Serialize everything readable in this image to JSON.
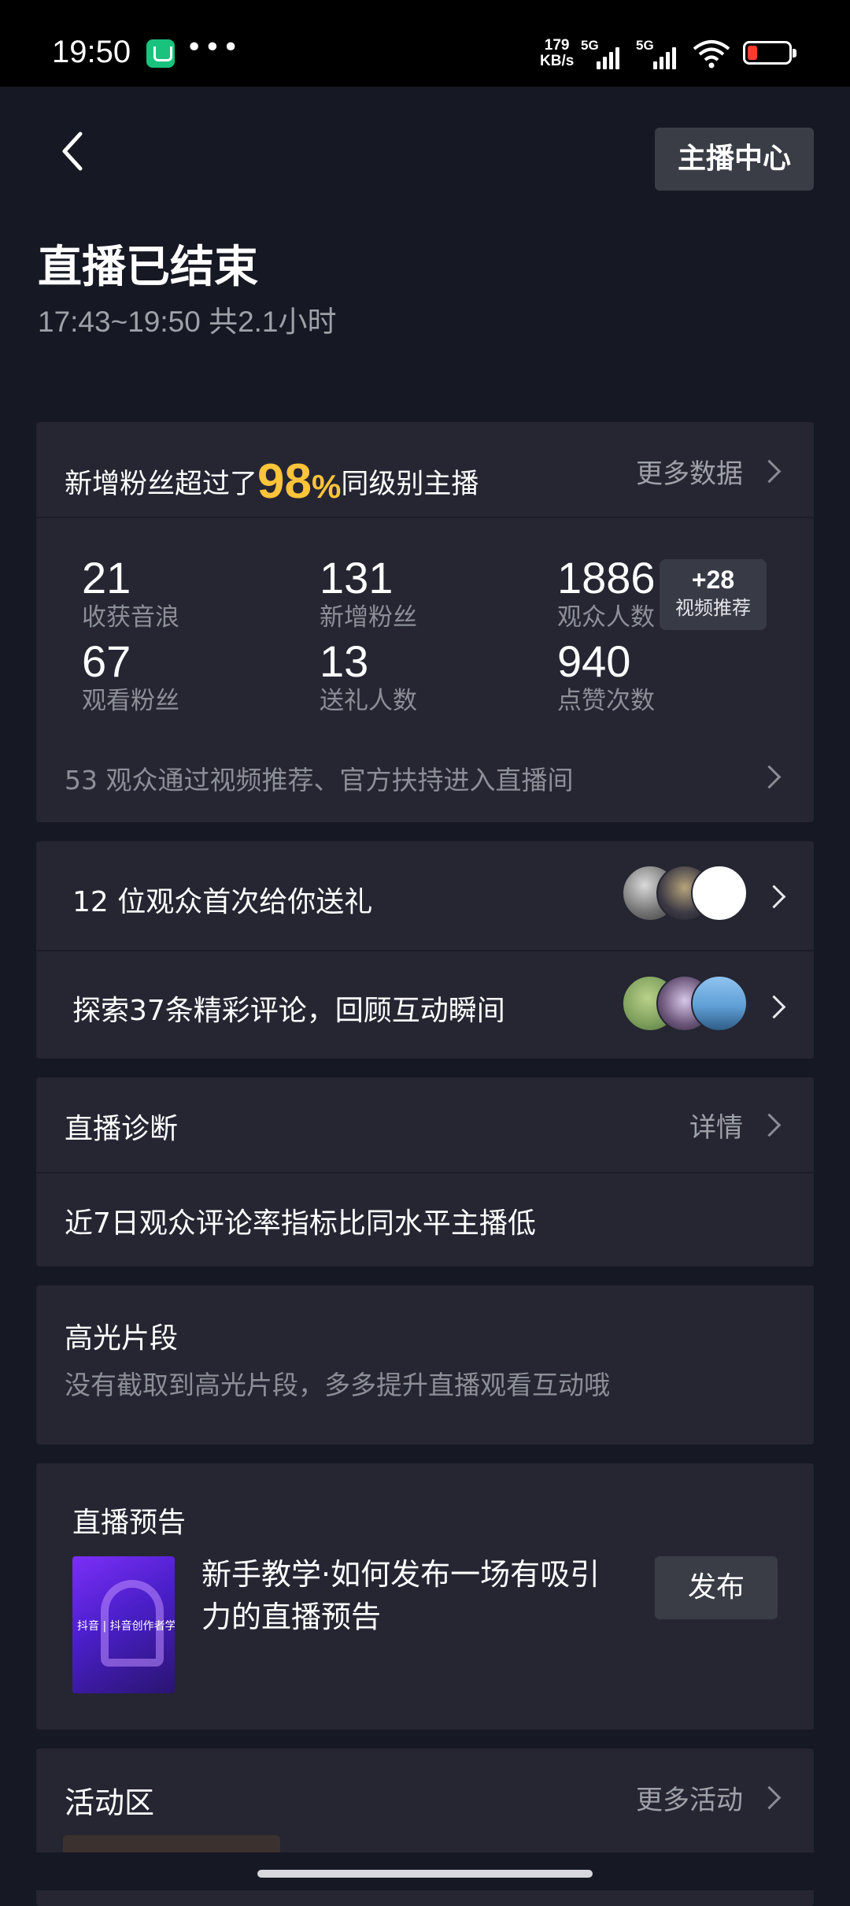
{
  "status_bar": {
    "time": "19:50",
    "speed_value": "179",
    "speed_unit": "KB/s",
    "network1": "5G",
    "network2": "5G",
    "battery_color": "#ff3b30"
  },
  "header": {
    "back_icon": "chevron-left-icon",
    "center_button": "主播中心",
    "title": "直播已结束",
    "subtitle": "17:43~19:50 共2.1小时"
  },
  "summary": {
    "fans_prefix": "新增粉丝超过了",
    "fans_percent": "98",
    "fans_percent_sign": "%",
    "fans_suffix": "同级别主播",
    "more_data": "更多数据",
    "stats": [
      {
        "value": "21",
        "label": "收获音浪"
      },
      {
        "value": "131",
        "label": "新增粉丝"
      },
      {
        "value": "1886",
        "label": "观众人数"
      },
      {
        "value": "67",
        "label": "观看粉丝"
      },
      {
        "value": "13",
        "label": "送礼人数"
      },
      {
        "value": "940",
        "label": "点赞次数"
      }
    ],
    "badge_value": "+28",
    "badge_label": "视频推荐",
    "recommend_line": "53 观众通过视频推荐、官方扶持进入直播间"
  },
  "gifts": {
    "text": "12 位观众首次给你送礼"
  },
  "comments": {
    "text": "探索37条精彩评论，回顾互动瞬间"
  },
  "diagnosis": {
    "title": "直播诊断",
    "detail": "详情",
    "message": "近7日观众评论率指标比同水平主播低"
  },
  "highlights": {
    "title": "高光片段",
    "message": "没有截取到高光片段，多多提升直播观看互动哦"
  },
  "preview": {
    "title": "直播预告",
    "thumb_text": "抖音 | 抖音创作者学院",
    "text": "新手教学·如何发布一场有吸引力的直播预告",
    "publish": "发布"
  },
  "activity": {
    "title": "活动区",
    "more": "更多活动"
  },
  "colors": {
    "background": "#161823",
    "card": "#252632",
    "accent": "#ffc43a",
    "button": "#3a3c46"
  }
}
